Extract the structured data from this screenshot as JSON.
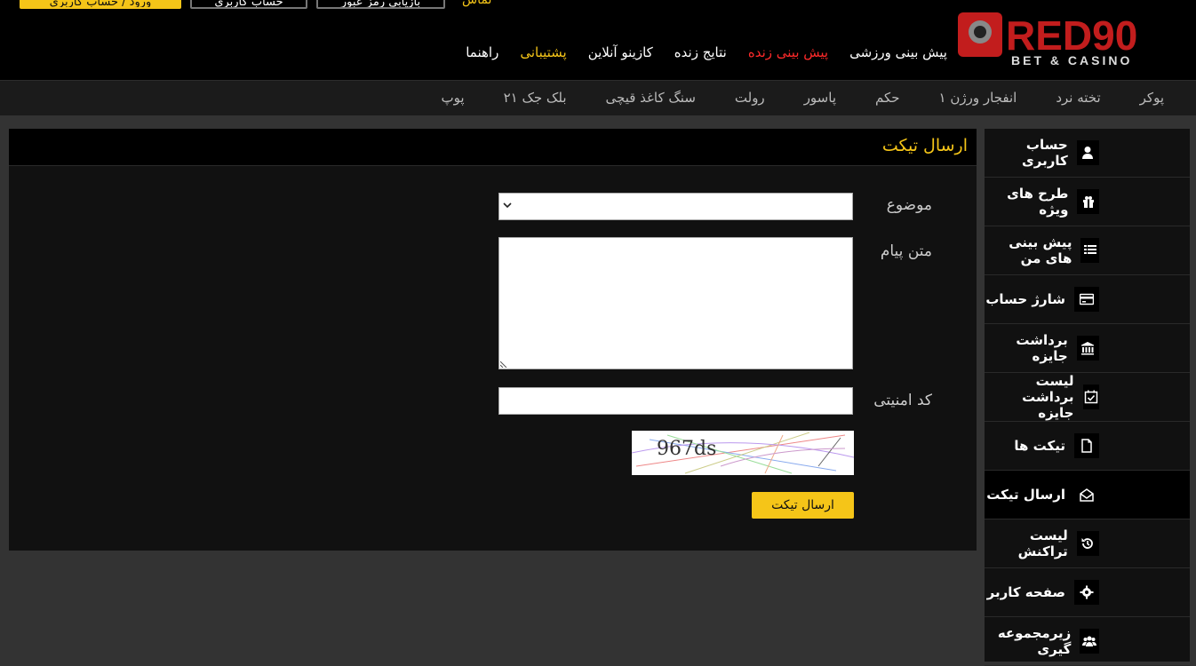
{
  "header": {
    "top_buttons": {
      "login": "ورود / حساب کاربری",
      "register": "حساب کاربری",
      "recover": "بازیابی رمز عبور"
    },
    "top_extra": "تماس",
    "logo": {
      "brand": "RED90",
      "tagline": "BET & CASINO"
    },
    "main_nav": [
      {
        "label": "پیش بینی ورزشی",
        "color": "#ffffff"
      },
      {
        "label": "پیش بینی زنده",
        "color": "#ff2a2a"
      },
      {
        "label": "نتایج زنده",
        "color": "#ffffff"
      },
      {
        "label": "کازینو آنلاین",
        "color": "#ffffff"
      },
      {
        "label": "پشتیبانی",
        "color": "#f5c518"
      },
      {
        "label": "راهنما",
        "color": "#ffffff"
      }
    ]
  },
  "sub_nav": [
    "پوکر",
    "تخته نرد",
    "انفجار ورژن ۱",
    "حکم",
    "پاسور",
    "رولت",
    "سنگ کاغذ قیچی",
    "بلک جک ۲۱",
    "پوپ"
  ],
  "sidebar": {
    "items": [
      {
        "label": "حساب کاربری",
        "icon": "user-icon"
      },
      {
        "label": "طرح های ویژه",
        "icon": "gift-icon"
      },
      {
        "label": "پیش بینی های من",
        "icon": "list-icon"
      },
      {
        "label": "شارژ حساب",
        "icon": "credit-card-icon"
      },
      {
        "label": "برداشت جایزه",
        "icon": "bank-icon"
      },
      {
        "label": "لیست برداشت جایزه",
        "icon": "calendar-check-icon"
      },
      {
        "label": "تیکت ها",
        "icon": "file-icon"
      },
      {
        "label": "ارسال تیکت",
        "icon": "envelope-open-icon",
        "active": true
      },
      {
        "label": "لیست تراکنش",
        "icon": "history-icon"
      },
      {
        "label": "صفحه کاربر",
        "icon": "gear-icon"
      },
      {
        "label": "زیرمجموعه گیری",
        "icon": "users-icon"
      }
    ]
  },
  "panel": {
    "title": "ارسال تیکت",
    "subject_label": "موضوع",
    "subject_value": "",
    "message_label": "متن پیام",
    "message_value": "",
    "security_label": "کد امنیتی",
    "security_value": "",
    "captcha_text": "967ds",
    "submit_label": "ارسال تیکت"
  },
  "colors": {
    "accent": "#f5c518",
    "live": "#ff2a2a",
    "background": "#333333",
    "panel": "#111111"
  }
}
